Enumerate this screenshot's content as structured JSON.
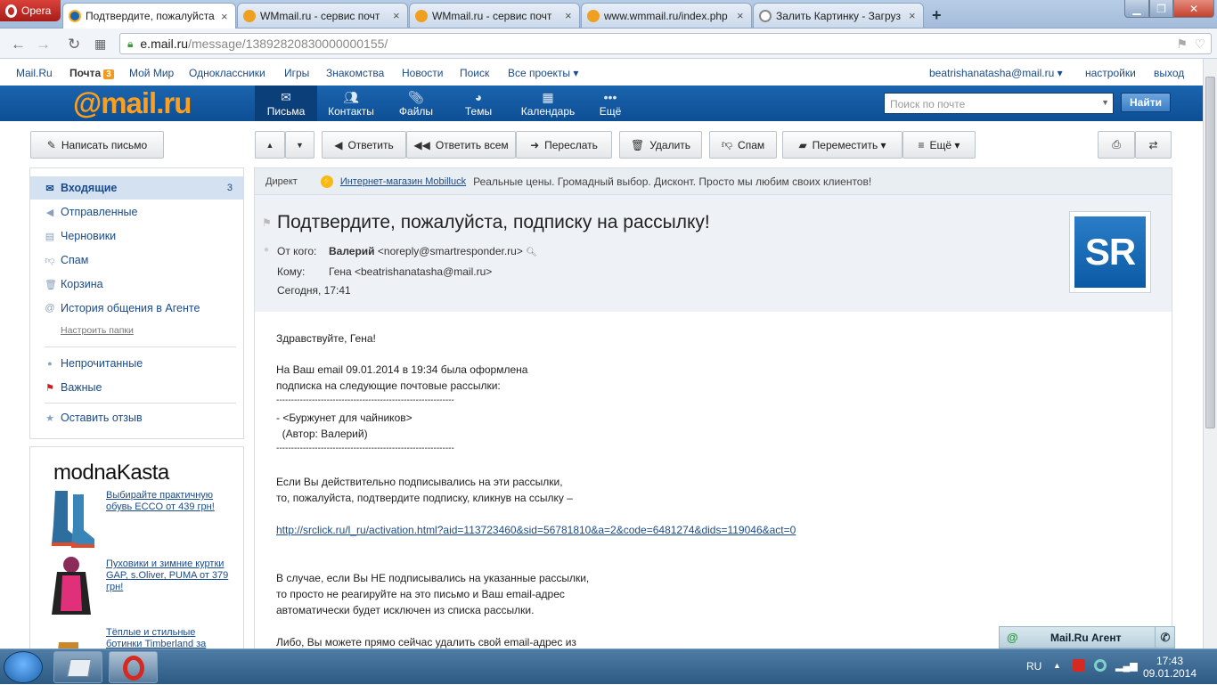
{
  "browser": {
    "menu_label": "Opera",
    "tabs": [
      {
        "title": "Подтвердите, пожалуйста"
      },
      {
        "title": "WMmail.ru - сервис почт"
      },
      {
        "title": "WMmail.ru - сервис почт"
      },
      {
        "title": "www.wmmail.ru/index.php"
      },
      {
        "title": "Залить Картинку - Загруз"
      }
    ],
    "url_domain": "e.mail.ru",
    "url_path": "/message/13892820830000000155/"
  },
  "portal": {
    "links": [
      "Mail.Ru",
      "Почта",
      "Мой Мир",
      "Одноклассники",
      "Игры",
      "Знакомства",
      "Новости",
      "Поиск",
      "Все проекты ▾"
    ],
    "mail_badge": "3",
    "user_email": "beatrishanatasha@mail.ru ▾",
    "settings": "настройки",
    "logout": "выход"
  },
  "header": {
    "logo_at": "@",
    "logo_text": "mail",
    "logo_ru": ".ru",
    "nav": [
      {
        "label": "Письма",
        "icon": "envelope-icon"
      },
      {
        "label": "Контакты",
        "icon": "contacts-icon"
      },
      {
        "label": "Файлы",
        "icon": "paperclip-icon"
      },
      {
        "label": "Темы",
        "icon": "palette-icon"
      },
      {
        "label": "Календарь",
        "icon": "calendar-icon"
      },
      {
        "label": "Ещё",
        "icon": "more-dots-icon"
      }
    ],
    "search_placeholder": "Поиск по почте",
    "search_button": "Найти"
  },
  "toolbar": {
    "compose": "Написать письмо",
    "reply": "Ответить",
    "reply_all": "Ответить всем",
    "forward": "Переслать",
    "delete": "Удалить",
    "spam": "Спам",
    "move": "Переместить ▾",
    "more": "Ещё ▾"
  },
  "sidebar": {
    "folders": [
      {
        "label": "Входящие",
        "count": "3"
      },
      {
        "label": "Отправленные"
      },
      {
        "label": "Черновики"
      },
      {
        "label": "Спам"
      },
      {
        "label": "Корзина"
      },
      {
        "label": "История общения в Агенте"
      }
    ],
    "configure": "Настроить папки",
    "unread": "Непрочитанные",
    "important": "Важные",
    "feedback": "Оставить отзыв"
  },
  "ad": {
    "brand": "modnaKasta",
    "items": [
      "Выбирайте практичную обувь ECCO от 439 грн!",
      "Пуховики и зимние куртки GAP, s.Oliver, PUMA от 379 грн!",
      "Тёплые и стильные ботинки Timberland за"
    ]
  },
  "direct": {
    "label": "Директ",
    "link": "Интернет-магазин Mobilluck",
    "text": "Реальные цены. Громадный выбор. Дисконт. Просто мы любим своих клиентов!"
  },
  "message": {
    "subject": "Подтвердите, пожалуйста, подписку на рассылку!",
    "from_label": "От кого:",
    "from_name": "Валерий",
    "from_email": "<noreply@smartresponder.ru>",
    "to_label": "Кому:",
    "to_value": "Гена <beatrishanatasha@mail.ru>",
    "date": "Сегодня, 17:41",
    "avatar_text": "SR",
    "body": [
      "Здравствуйте, Гена!",
      "На Ваш email 09.01.2014 в 19:34 была оформлена",
      "подписка на следующие почтовые рассылки:",
      "------------------------------------------------------------",
      "- <Буржунет для чайников>",
      "  (Автор: Валерий)",
      "------------------------------------------------------------",
      "Если Вы действительно подписывались на эти рассылки,",
      "то, пожалуйста, подтвердите подписку, кликнув на ссылку –",
      "http://srclick.ru/l_ru/activation.html?aid=113723460&sid=56781810&a=2&code=6481274&dids=119046&act=0",
      "В случае, если Вы НЕ подписывались на указанные рассылки,",
      "то просто не реагируйте на это письмо и Ваш email-адрес",
      "автоматически будет исключен из списка рассылки.",
      "Либо, Вы можете прямо сейчас удалить свой email-адрес из"
    ]
  },
  "agent": {
    "label": "Mail.Ru Агент"
  },
  "taskbar": {
    "lang": "RU",
    "time": "17:43",
    "date": "09.01.2014"
  },
  "colors": {
    "header_blue": "#1b64ae",
    "logo_orange": "#ff9e1a",
    "link_blue": "#1a4b8a",
    "selected_folder": "#d3e1f0"
  }
}
